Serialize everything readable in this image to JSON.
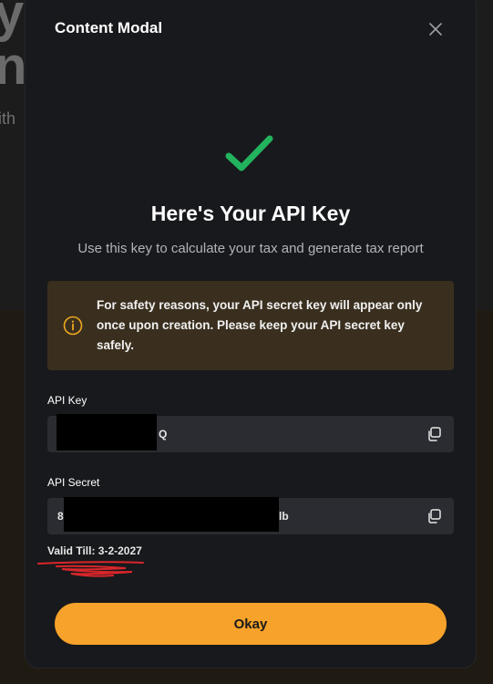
{
  "modal": {
    "title": "Content Modal",
    "heading": "Here's Your API Key",
    "subheading": "Use this key to calculate your tax and generate tax report",
    "warning": "For safety reasons, your API secret key will appear only once upon creation. Please keep your API secret key safely.",
    "api_key": {
      "label": "API Key",
      "visible_suffix": "Q"
    },
    "api_secret": {
      "label": "API Secret",
      "visible_prefix": "8",
      "visible_suffix": "lb"
    },
    "valid_till": "Valid Till: 3-2-2027",
    "okay_label": "Okay"
  },
  "background": {
    "fragment_1": "y",
    "fragment_2": "n",
    "fragment_3": "ith"
  },
  "colors": {
    "accent": "#f7a22b",
    "success": "#22b35e",
    "warning_bg": "#3a2f1e",
    "warning_icon": "#f0a820",
    "modal_bg": "#18191c",
    "field_bg": "#2a2c31"
  },
  "icons": {
    "close": "close-icon",
    "success": "check-icon",
    "warning": "info-icon",
    "copy": "copy-icon"
  }
}
